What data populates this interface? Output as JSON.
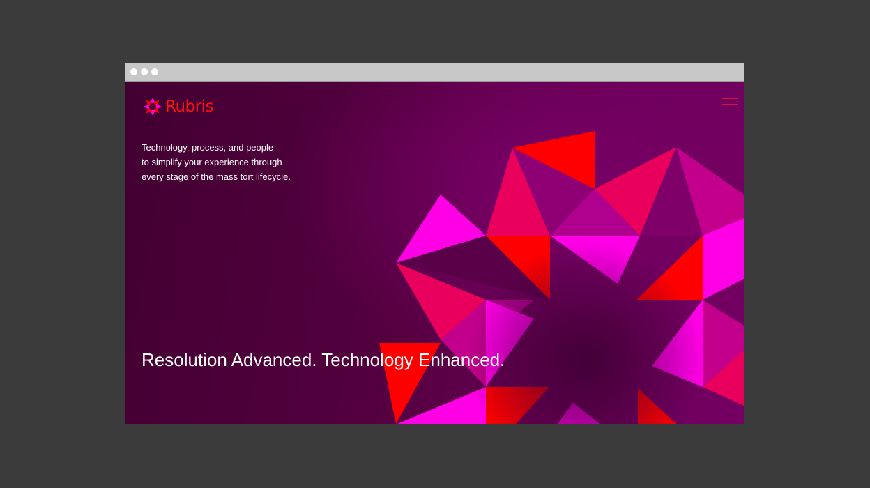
{
  "window": {
    "controls": [
      "close",
      "minimize",
      "maximize"
    ]
  },
  "header": {
    "brand": "Rubris",
    "logo_icon": "rubris-star-logo-icon",
    "menu_icon": "hamburger-menu-icon"
  },
  "hero": {
    "intro_lines": [
      "Technology, process, and people",
      "to simplify your experience through",
      "every stage of the mass tort lifecycle."
    ],
    "headline": "Resolution Advanced. Technology Enhanced."
  },
  "colors": {
    "background_dark": "#420031",
    "background_light": "#740062",
    "brand_red": "#ff1010",
    "magenta": "#ff00e6",
    "crimson": "#e8005c",
    "red": "#ff0000",
    "purple": "#b0008e"
  }
}
